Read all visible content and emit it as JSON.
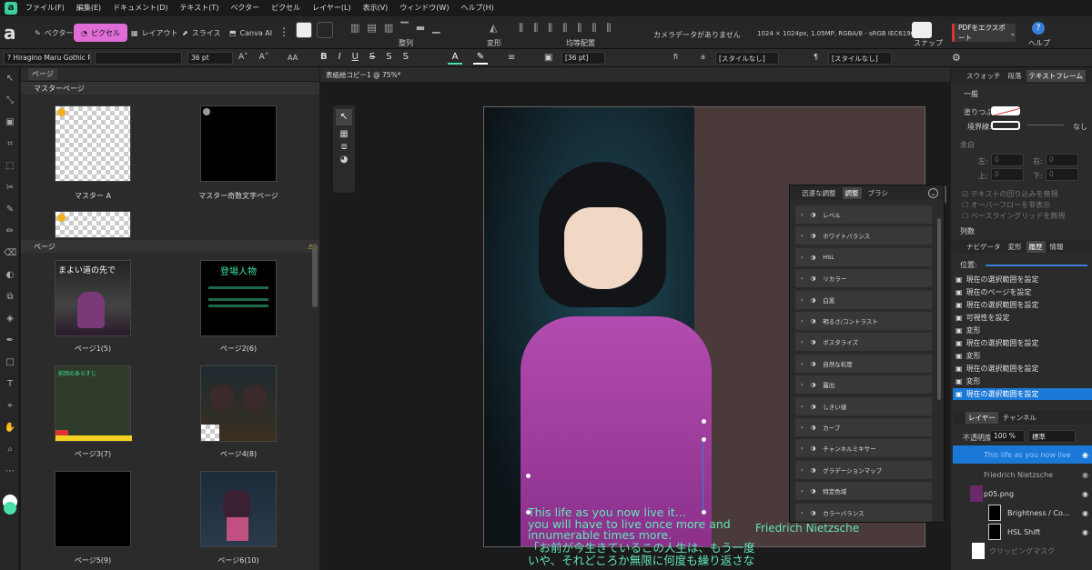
{
  "menu": [
    "ファイル(F)",
    "編集(E)",
    "ドキュメント(D)",
    "テキスト(T)",
    "ベクター",
    "ピクセル",
    "レイヤー(L)",
    "表示(V)",
    "ウィンドウ(W)",
    "ヘルプ(H)"
  ],
  "personas": {
    "vector": "ベクター",
    "pixel": "ピクセル",
    "layout": "レイアウト",
    "slice": "スライス",
    "canva": "Canva AI"
  },
  "toolbar": {
    "align": "整列",
    "transform": "変形",
    "distribute": "均等配置",
    "camera": "カメラデータがありません",
    "docinfo": "1024 × 1024px, 1.05MP, RGBA/8 - sRGB IEC61966-2.1",
    "snap": "スナップ",
    "export": "PDFをエクスポート",
    "help": "ヘルプ"
  },
  "ctx": {
    "font": "? Hiragino Maru Gothic Pro",
    "size": "36 pt",
    "leading": "[36 pt]",
    "style1": "[スタイルなし]",
    "style2": "[スタイルなし]",
    "aa": "AA",
    "fi": "fi",
    "a": "a",
    "para": "¶"
  },
  "left": {
    "tab": "ページ",
    "master_header": "マスターページ",
    "masters": [
      "マスター A",
      "マスター奇数文字ページ"
    ],
    "pages_header": "ページ",
    "pages": [
      "ページ1(5)",
      "ページ2(6)",
      "ページ3(7)",
      "ページ4(8)",
      "ページ5(9)",
      "ページ6(10)"
    ],
    "p1_text": "まよい道の先で",
    "p2_title": "登場人物",
    "p3_label": "前回のあらすじ"
  },
  "doc": {
    "tab": "表紙絵コピー1 @ 75%*",
    "text_en": "This life as you now live it…\nyou will have to live once more and\ninnumerable times more.",
    "text_ja": "「お前が今生きているこの人生は、もう一度\nいや、それどころか無限に何度も繰り返さな",
    "author": "Friedrich Nietzsche"
  },
  "adj": {
    "tabs": [
      "迅速な調整",
      "調整",
      "ブラシ"
    ],
    "items": [
      "レベル",
      "ホワイトバランス",
      "HSL",
      "リカラー",
      "白黒",
      "明るさ/コントラスト",
      "ポスタライズ",
      "自然な彩度",
      "露出",
      "しきい値",
      "カーブ",
      "チャンネルミキサー",
      "グラデーションマップ",
      "特定色域",
      "カラーバランス"
    ]
  },
  "right": {
    "tabs1": [
      "スウォッチ",
      "段落",
      "テキストフレーム"
    ],
    "general": "一般",
    "fill": "塗りつぶし:",
    "border": "境界線:",
    "none": "なし",
    "margin": "余白",
    "left": "左:",
    "right": "右:",
    "top": "上:",
    "bottom": "下:",
    "zero": "0",
    "chk1": "テキストの回り込みを無視",
    "chk2": "オーバーフローを非表示",
    "chk3": "ベースライングリッドを無視",
    "columns": "列数",
    "tabs2": [
      "ナビゲータ",
      "変形",
      "履歴",
      "情報"
    ],
    "pos": "位置:",
    "history": [
      "現在の選択範囲を設定",
      "現在のページを設定",
      "現在の選択範囲を設定",
      "可視性を設定",
      "変形",
      "現在の選択範囲を設定",
      "変形",
      "現在の選択範囲を設定",
      "変形",
      "現在の選択範囲を設定"
    ],
    "tabs3": [
      "レイヤー",
      "チャンネル"
    ],
    "opacity": "不透明度:",
    "opacity_val": "100 %",
    "blend": "標準",
    "layers": [
      "This life as you now live",
      "Friedrich Nietzsche",
      "p05.png",
      "Brightness / Co...",
      "HSL Shift",
      "クリッピングマスク"
    ]
  },
  "colors": {
    "accent": "#e06cd6",
    "select": "#1a78d6",
    "text": "#62e6b8"
  }
}
